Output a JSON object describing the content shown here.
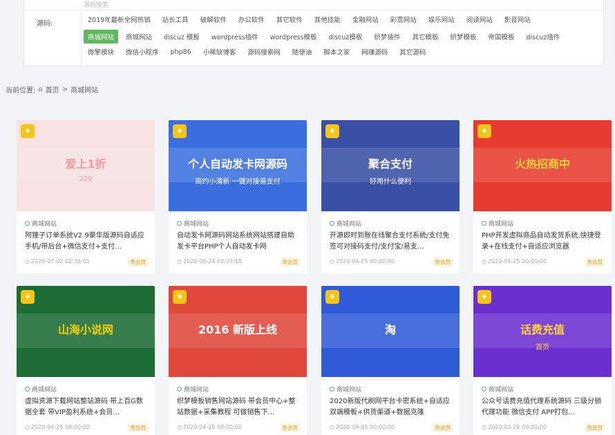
{
  "filter": {
    "top_text": "源码搜索",
    "label": "源码:",
    "rows": [
      [
        "2019年最新全网热销",
        "站长工具",
        "破解软件",
        "办公软件",
        "其它软件",
        "其他技能",
        "金融网站",
        "彩票网站",
        "娱乐网站",
        "阅读网站",
        "影音网站"
      ],
      [
        "商城网站",
        "商城网站",
        "discuz 模板",
        "wordpress插件",
        "wordpress模板",
        "discuz模板",
        "织梦插件",
        "其它模板",
        "织梦模板",
        "帝国模板",
        "discuz插件"
      ],
      [
        "微擎模块",
        "微信小程序",
        "php86",
        "小稀缺博客",
        "源码搜索网",
        "随便油",
        "脚本之家",
        "网赚源码",
        "其它源码"
      ]
    ],
    "active": "商城网站"
  },
  "breadcrumb": {
    "prefix": "当前位置:",
    "home_icon": "home-icon",
    "home": "首页",
    "sep": ">",
    "current": "商城网站"
  },
  "cards": [
    {
      "category": "商城网站",
      "title": "阿狸子订单系统V2.9豪华版源码自适应手机/带后台+微信支付+支付…",
      "date": "2020-07-02 02:36:01",
      "price": "免会员",
      "thumb_color": "#f6e2e2",
      "thumb_text": "爱上1折",
      "thumb_accent": "#f49aa0",
      "thumb_caption": "229"
    },
    {
      "category": "商城网站",
      "title": "自动发卡网源码网站系统网站搭建自助发卡平台PHP个人自动发卡网",
      "date": "2020-05-24 02:33:18",
      "price": "免会员",
      "thumb_color": "#3b6fe0",
      "thumb_text": "个人自动发卡网源码",
      "thumb_accent": "#ffffff",
      "thumb_caption": "简约小清新 一键对接易支付"
    },
    {
      "category": "商城网站",
      "title": "开源即时到账在线聚合支付系统/支付免签可对接码支付/支付宝/易支…",
      "date": "2020-04-25 00:00:00",
      "price": "免会员",
      "thumb_color": "#3a4fa6",
      "thumb_text": "聚合支付",
      "thumb_accent": "#ffffff",
      "thumb_caption": "好用什么便利"
    },
    {
      "category": "商城网站",
      "title": "PHP开发虚拟商品自动发货系统,快捷登录+在线支付+自适应浏览器",
      "date": "2020-04-25 00:00:00",
      "price": "免会员",
      "thumb_color": "#e63b2e",
      "thumb_text": "火热招商中",
      "thumb_accent": "#ffd23a",
      "thumb_caption": ""
    },
    {
      "category": "商城网站",
      "title": "虚拟资源下载网站整站源码 带上百G数据全套 带VIP盈利系统+会员…",
      "date": "2020-04-25 00:00:00",
      "price": "免会员",
      "thumb_color": "#1d6b35",
      "thumb_text": "山海小说网",
      "thumb_accent": "#f0d000",
      "thumb_caption": ""
    },
    {
      "category": "商城网站",
      "title": "织梦模板销售网站源码 带会员中心+整站数据+采集教程 可做销售下…",
      "date": "2020-04-25 00:00:00",
      "price": "免会员",
      "thumb_color": "#e0473b",
      "thumb_text": "2016 新版上线",
      "thumb_accent": "#ffffff",
      "thumb_caption": ""
    },
    {
      "category": "商城网站",
      "title": "2020新版代刷网平台卡密系统+自适应双端模板+供货渠道+数据克隆",
      "date": "2020-04-05 00:00:00",
      "price": "免会员",
      "thumb_color": "#2f5ad8",
      "thumb_text": "淘",
      "thumb_accent": "#ffffff",
      "thumb_caption": ""
    },
    {
      "category": "商城网站",
      "title": "公众号话费充值代理系统源码 三级分销代理功能 微信支付 APP打包…",
      "date": "2020-03-25 00:00:00",
      "price": "免会员",
      "thumb_color": "#6a2fd0",
      "thumb_text": "话费充值",
      "thumb_accent": "#ffd23a",
      "thumb_caption": "首页"
    }
  ],
  "colors": {
    "active_tag": "#5fb85f",
    "badge": "#f5c518",
    "price": "#e0a020"
  }
}
